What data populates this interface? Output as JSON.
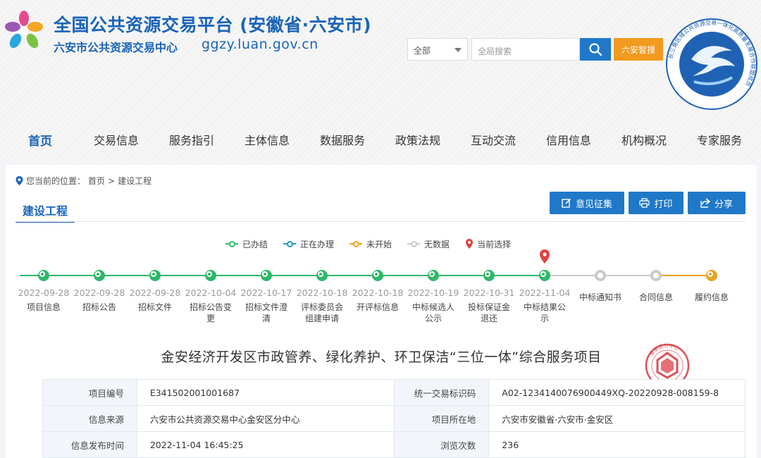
{
  "header": {
    "title_main": "全国公共资源交易平台 (安徽省·六安市)",
    "title_sub": "六安市公共资源交易中心",
    "url": "ggzy.luan.gov.cn",
    "search": {
      "scope": "全部",
      "placeholder": "全局搜索",
      "smart_label": "六安智搜"
    },
    "emblem_ring_text": "长三角区域公共资源交易一体化高质量发展合作联盟成员"
  },
  "nav": {
    "items": [
      "首页",
      "交易信息",
      "服务指引",
      "主体信息",
      "数据服务",
      "政策法规",
      "互动交流",
      "信用信息",
      "机构概况",
      "专家服务"
    ],
    "active_index": 0
  },
  "breadcrumb": {
    "prefix": "您当前的位置：",
    "home": "首页",
    "separator": ">",
    "current": "建设工程"
  },
  "tab": {
    "title": "建设工程"
  },
  "actions": {
    "feedback": "意见征集",
    "print": "打印",
    "share": "分享"
  },
  "legend": {
    "done": "已办结",
    "in_progress": "正在办理",
    "not_started": "未开始",
    "no_data": "无数据",
    "current": "当前选择",
    "colors": {
      "done": "#2fb86a",
      "in_progress": "#2196c9",
      "not_started": "#e9a21e",
      "no_data": "#c9c9c9",
      "current": "#e0413a"
    }
  },
  "timeline": {
    "steps": [
      {
        "date": "2022-09-28",
        "label": "项目信息",
        "status": "done"
      },
      {
        "date": "2022-09-28",
        "label": "招标公告",
        "status": "done"
      },
      {
        "date": "2022-09-28",
        "label": "招标文件",
        "status": "done"
      },
      {
        "date": "2022-10-04",
        "label": "招标公告变更",
        "status": "done"
      },
      {
        "date": "2022-10-17",
        "label": "招标文件澄清",
        "status": "done"
      },
      {
        "date": "2022-10-18",
        "label": "评标委员会组建申请",
        "status": "done"
      },
      {
        "date": "2022-10-18",
        "label": "开评标信息",
        "status": "done"
      },
      {
        "date": "2022-10-19",
        "label": "中标候选人公示",
        "status": "done"
      },
      {
        "date": "2022-10-31",
        "label": "投标保证金退还",
        "status": "done"
      },
      {
        "date": "2022-11-04",
        "label": "中标结果公示",
        "status": "done",
        "current": true
      },
      {
        "date": "",
        "label": "中标通知书",
        "status": "no_data"
      },
      {
        "date": "",
        "label": "合同信息",
        "status": "no_data"
      },
      {
        "date": "",
        "label": "履约信息",
        "status": "not_started"
      }
    ]
  },
  "project": {
    "title": "金安经济开发区市政管养、绿化养护、环卫保洁“三位一体”综合服务项目",
    "seal_text": "金安区分中心"
  },
  "info": {
    "rows": [
      {
        "l1": "项目编号",
        "v1": "E341502001001687",
        "l2": "统一交易标识码",
        "v2": "A02-1234140076900449XQ-20220928-008159-8"
      },
      {
        "l1": "信息来源",
        "v1": "六安市公共资源交易中心金安区分中心",
        "l2": "项目所在地",
        "v2": "六安市安徽省·六安市·金安区"
      },
      {
        "l1": "信息发布时间",
        "v1": "2022-11-04 16:45:25",
        "l2": "浏览次数",
        "v2": "236"
      }
    ]
  }
}
